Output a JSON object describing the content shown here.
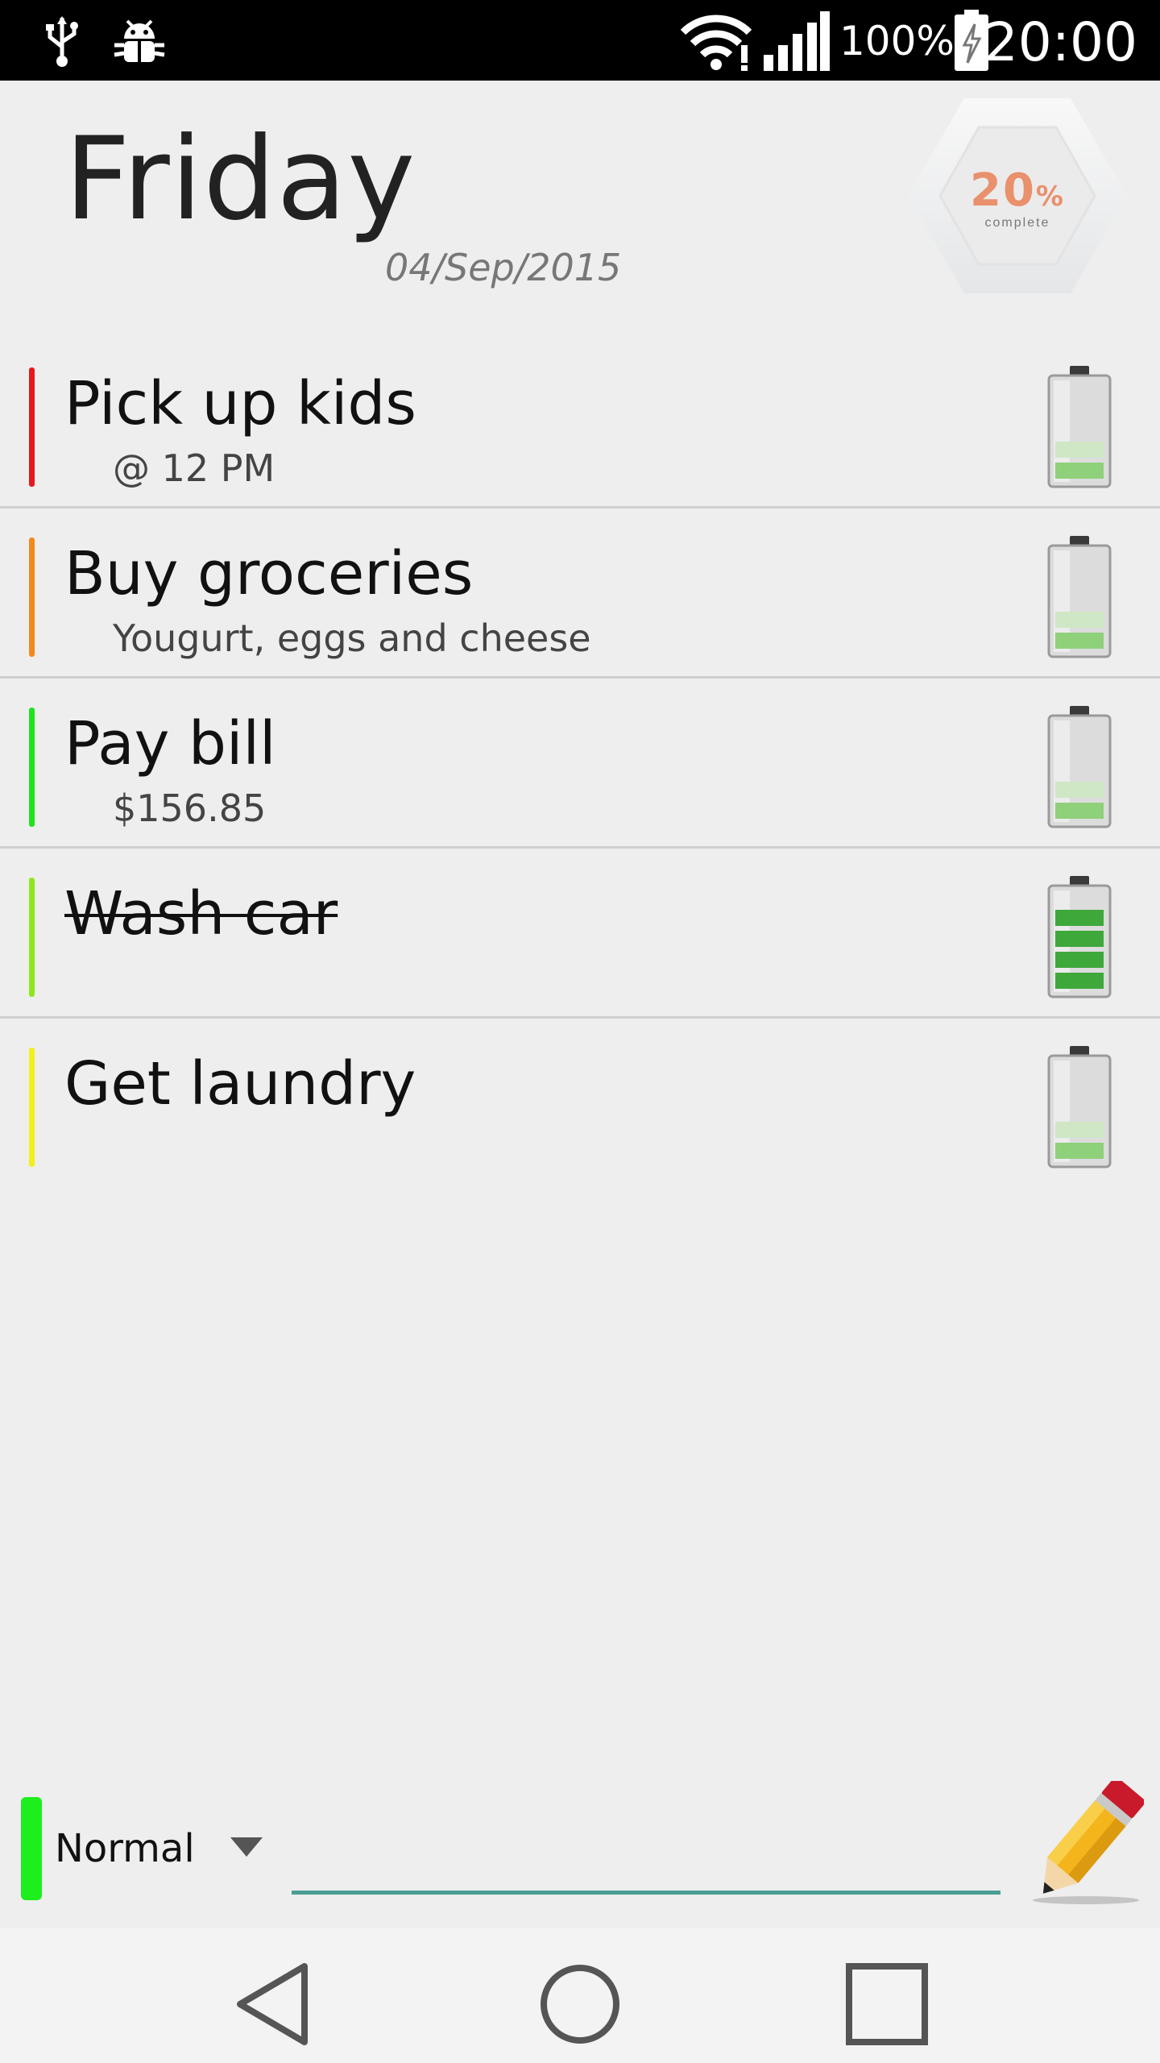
{
  "status_bar": {
    "battery_percent": "100%",
    "time": "20:00",
    "icons": [
      "usb-icon",
      "debug-icon",
      "wifi-icon",
      "signal-icon",
      "battery-charging-icon"
    ]
  },
  "header": {
    "day": "Friday",
    "date": "04/Sep/2015",
    "progress_value": "20",
    "progress_unit": "%",
    "progress_label": "complete",
    "progress_fraction": 0.2
  },
  "tasks": [
    {
      "title": "Pick up kids",
      "subtitle": "@ 12 PM",
      "color": "#e8171c",
      "done": false,
      "level": 1
    },
    {
      "title": "Buy groceries",
      "subtitle": "Yougurt, eggs and cheese",
      "color": "#f08a1c",
      "done": false,
      "level": 1
    },
    {
      "title": "Pay bill",
      "subtitle": "$156.85",
      "color": "#1de41d",
      "done": false,
      "level": 1
    },
    {
      "title": "Wash car",
      "subtitle": "",
      "color": "#8ce81a",
      "done": true,
      "level": 4
    },
    {
      "title": "Get laundry",
      "subtitle": "",
      "color": "#f2ef1a",
      "done": false,
      "level": 1
    }
  ],
  "input_bar": {
    "priority_label": "Normal",
    "priority_color": "#1dee1d",
    "placeholder": "",
    "accent_color": "#4a9e94"
  },
  "navigation": {
    "icons": [
      "back-icon",
      "home-icon",
      "recents-icon"
    ]
  }
}
